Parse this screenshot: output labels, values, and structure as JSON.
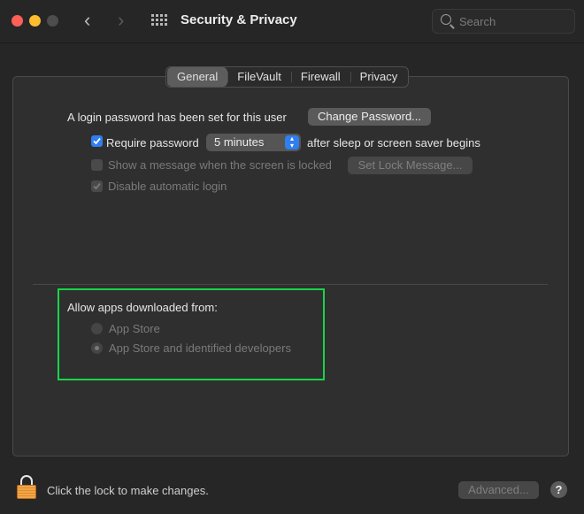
{
  "window": {
    "title": "Security & Privacy",
    "search_placeholder": "Search",
    "traffic_lights": {
      "close": "#fe5f57",
      "minimize": "#febc2e",
      "zoom": "#4d4d4d"
    }
  },
  "tabs": [
    {
      "label": "General",
      "active": true
    },
    {
      "label": "FileVault",
      "active": false
    },
    {
      "label": "Firewall",
      "active": false
    },
    {
      "label": "Privacy",
      "active": false
    }
  ],
  "general": {
    "login_password_text": "A login password has been set for this user",
    "change_password_label": "Change Password...",
    "require_password": {
      "label": "Require password",
      "checked": true,
      "enabled": true
    },
    "require_password_delay": "5 minutes",
    "after_sleep_text": "after sleep or screen saver begins",
    "show_message": {
      "label": "Show a message when the screen is locked",
      "checked": false,
      "enabled": false
    },
    "set_lock_message_label": "Set Lock Message...",
    "disable_auto_login": {
      "label": "Disable automatic login",
      "checked": true,
      "enabled": false
    }
  },
  "allow_apps": {
    "heading": "Allow apps downloaded from:",
    "options": [
      {
        "label": "App Store",
        "selected": false,
        "enabled": false
      },
      {
        "label": "App Store and identified developers",
        "selected": true,
        "enabled": false
      }
    ],
    "highlight_color": "#19d44a"
  },
  "footer": {
    "lock_text": "Click the lock to make changes.",
    "advanced_label": "Advanced...",
    "help_label": "?"
  }
}
